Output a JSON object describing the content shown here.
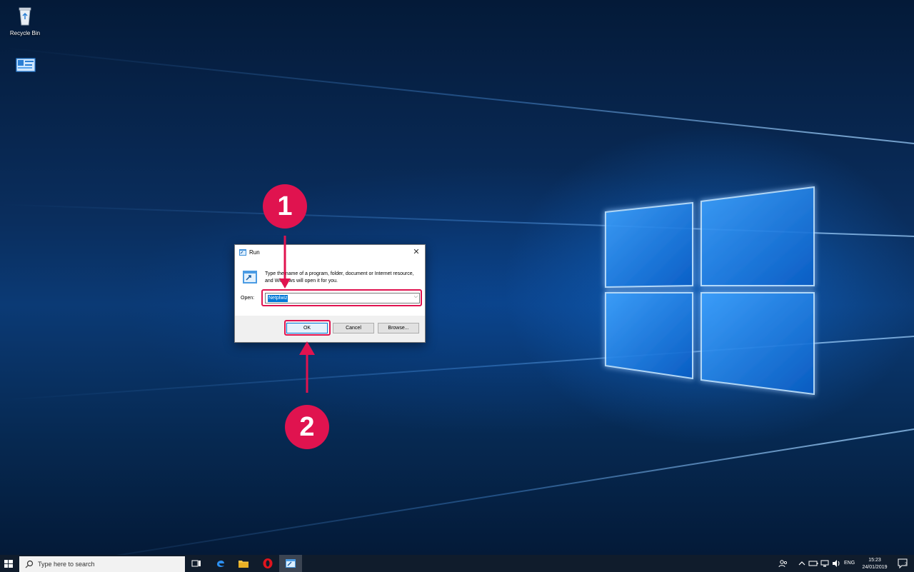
{
  "desktop": {
    "icons": [
      {
        "label": "Recycle Bin",
        "icon": "recycle-bin-icon"
      },
      {
        "label": "",
        "icon": "control-panel-icon"
      }
    ]
  },
  "run_dialog": {
    "title": "Run",
    "close_glyph": "✕",
    "description": "Type the name of a program, folder, document or Internet resource, and Windows will open it for you.",
    "open_label": "Open:",
    "open_value": "Netplwiz",
    "dropdown_glyph": "⌵",
    "buttons": {
      "ok": "OK",
      "cancel": "Cancel",
      "browse": "Browse..."
    }
  },
  "annotations": {
    "step1": "1",
    "step2": "2",
    "accent_color": "#e0134f"
  },
  "taskbar": {
    "search_placeholder": "Type here to search",
    "apps": [
      "task-view-icon",
      "edge-icon",
      "file-explorer-icon",
      "opera-icon",
      "run-app-icon"
    ],
    "language": "ENG",
    "time": "15:23",
    "date": "24/01/2019",
    "notification_count": "2"
  }
}
